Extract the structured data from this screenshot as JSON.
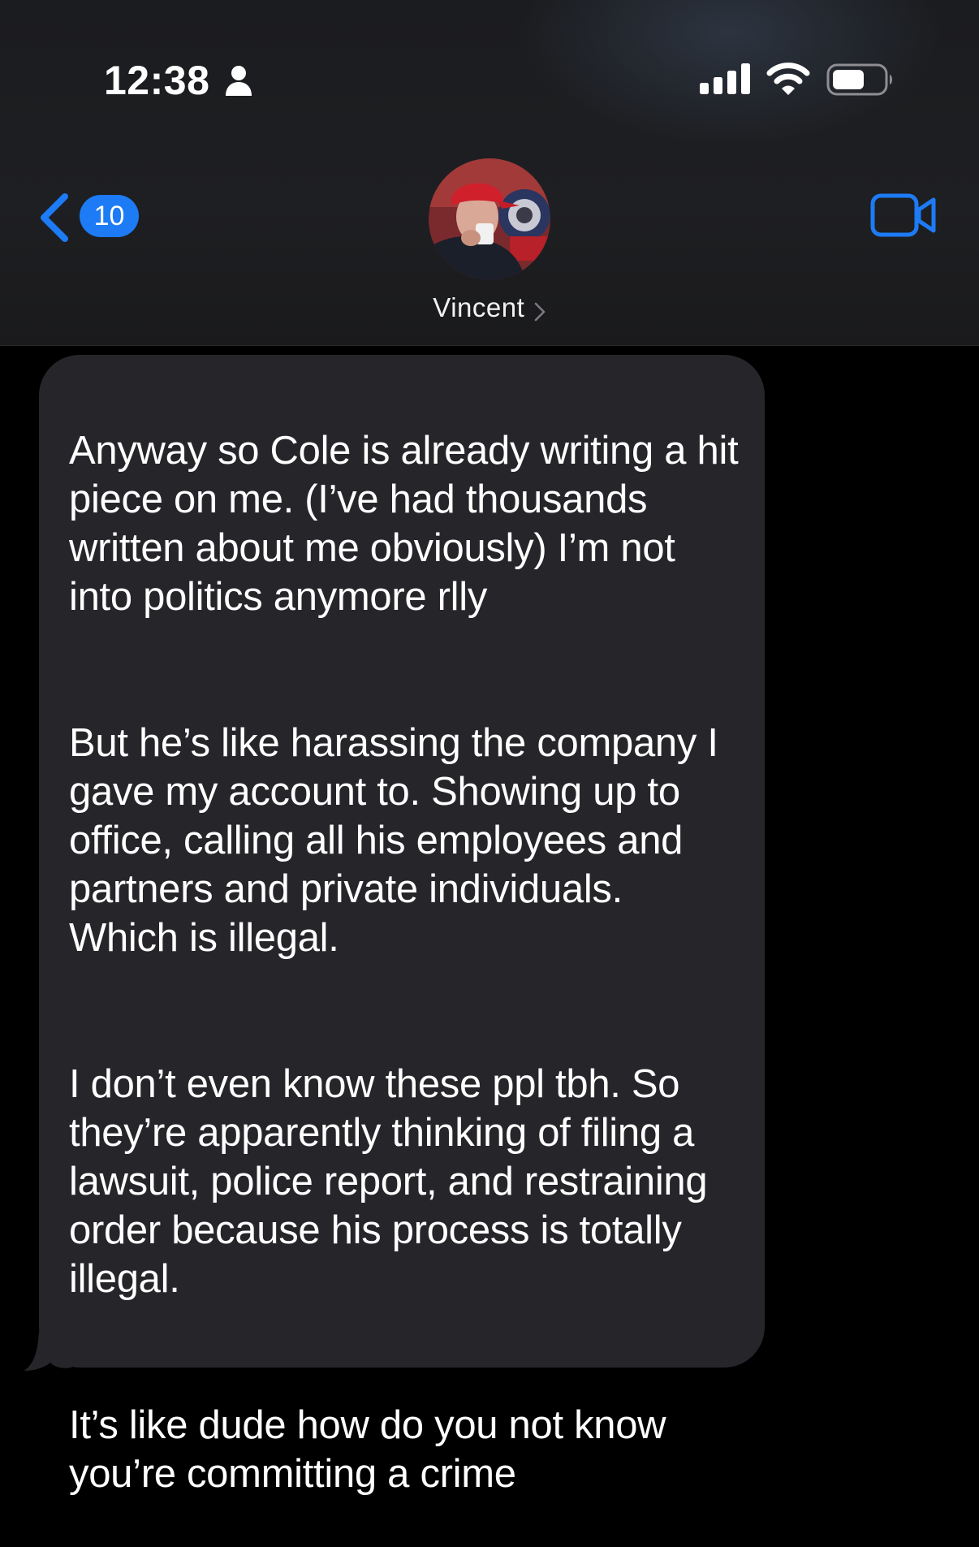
{
  "status_bar": {
    "time": "12:38",
    "icons": [
      "person-icon",
      "cellular-signal-icon",
      "wifi-icon",
      "battery-icon"
    ]
  },
  "nav": {
    "back_badge_count": "10",
    "contact_name": "Vincent",
    "icons": [
      "chevron-left-icon",
      "chevron-right-icon",
      "video-camera-icon"
    ]
  },
  "colors": {
    "accent": "#1d7bf5",
    "bubble": "#26262a",
    "background": "#000000"
  },
  "messages": [
    {
      "direction": "incoming",
      "paragraphs": [
        "Anyway so Cole is already writing a hit piece on me. (I’ve had thousands written about me obviously) I’m not into politics anymore rlly",
        "But he’s like harassing the company I gave my account to. Showing up to office, calling all his employees and partners and private individuals. Which is illegal.",
        "I don’t even know these ppl tbh. So they’re apparently thinking of filing  a lawsuit, police report, and restraining order because his process is totally illegal.",
        "It’s like dude how do you not know you’re committing a crime"
      ]
    }
  ]
}
